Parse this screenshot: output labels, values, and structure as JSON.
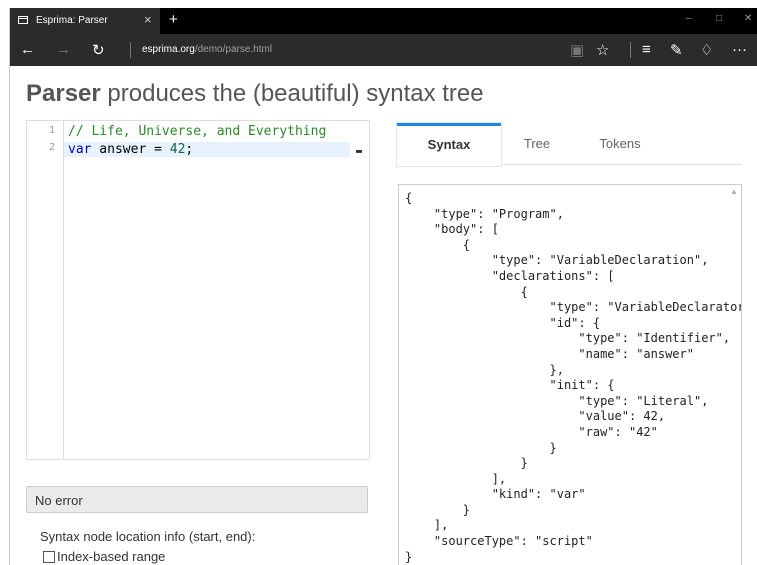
{
  "browser": {
    "tab_title": "Esprima: Parser",
    "tab_close": "×",
    "new_tab": "+",
    "url_domain": "esprima.org",
    "url_path": "/demo/parse.html",
    "more": "···"
  },
  "page": {
    "title_bold": "Parser",
    "title_rest": " produces the (beautiful) syntax tree"
  },
  "editor": {
    "lines": [
      {
        "num": "1",
        "text": "// Life, Universe, and Everything"
      },
      {
        "num": "2",
        "kw": "var",
        "mid": " answer = ",
        "num_val": "42",
        "end": ";"
      }
    ]
  },
  "status": {
    "message": "No error",
    "location_label": "Syntax node location info (start, end):",
    "index_range_label": "Index-based range"
  },
  "tabs": [
    "Syntax",
    "Tree",
    "Tokens"
  ],
  "syntax_output": "{\n    \"type\": \"Program\",\n    \"body\": [\n        {\n            \"type\": \"VariableDeclaration\",\n            \"declarations\": [\n                {\n                    \"type\": \"VariableDeclarator\",\n                    \"id\": {\n                        \"type\": \"Identifier\",\n                        \"name\": \"answer\"\n                    },\n                    \"init\": {\n                        \"type\": \"Literal\",\n                        \"value\": 42,\n                        \"raw\": \"42\"\n                    }\n                }\n            ],\n            \"kind\": \"var\"\n        }\n    ],\n    \"sourceType\": \"script\"\n}"
}
